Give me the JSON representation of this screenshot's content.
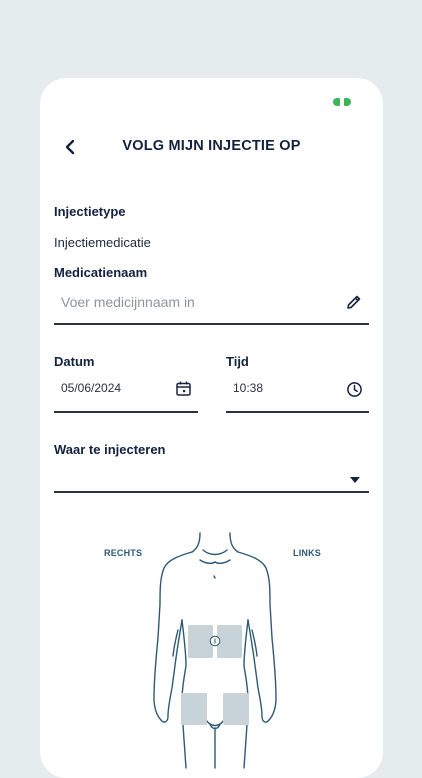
{
  "header": {
    "title": "VOLG MIJN INJECTIE OP",
    "back_icon": "chevron-left-icon"
  },
  "status": {
    "battery_color": "#3cb55a"
  },
  "form": {
    "injection_type_label": "Injectietype",
    "injection_type_value": "Injectiemedicatie",
    "medication_name_label": "Medicatienaam",
    "medication_name_placeholder": "Voer medicijnnaam in",
    "medication_name_value": "",
    "date_label": "Datum",
    "date_value": "05/06/2024",
    "time_label": "Tijd",
    "time_value": "10:38",
    "site_label": "Waar te injecteren",
    "site_value": ""
  },
  "body_map": {
    "right_label": "RECHTS",
    "left_label": "LINKS"
  },
  "colors": {
    "accent": "#1a2340",
    "zone": "#c7d3d8",
    "outline": "#2e5a74"
  }
}
